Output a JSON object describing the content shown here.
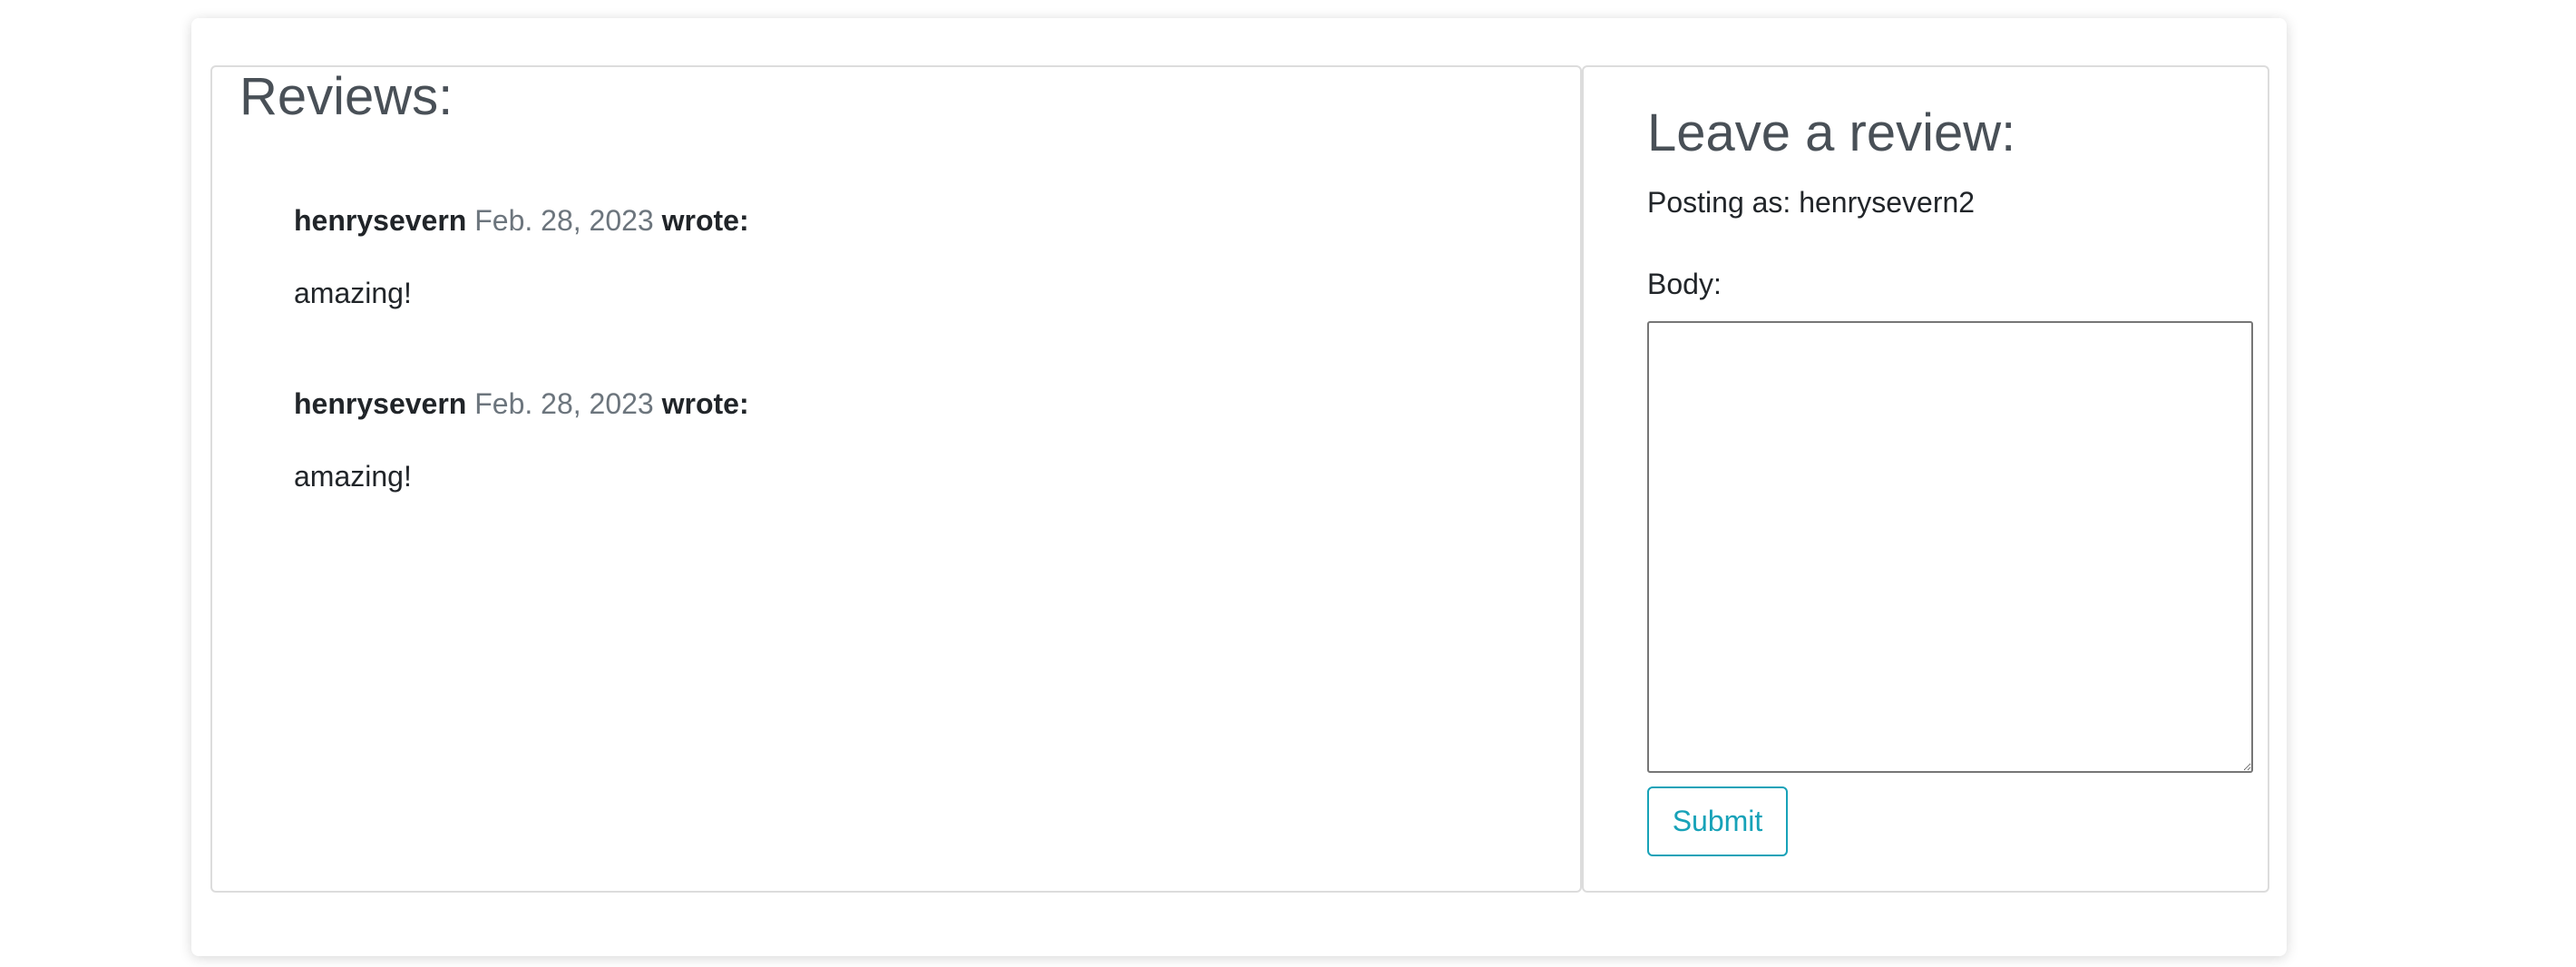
{
  "reviews": {
    "title": "Reviews:",
    "items": [
      {
        "author": "henrysevern",
        "date": "Feb. 28, 2023",
        "wrote": "wrote:",
        "body": "amazing!"
      },
      {
        "author": "henrysevern",
        "date": "Feb. 28, 2023",
        "wrote": "wrote:",
        "body": "amazing!"
      }
    ]
  },
  "form": {
    "title": "Leave a review:",
    "posting_as": "Posting as: henrysevern2",
    "body_label": "Body:",
    "body_value": "",
    "submit_label": "Submit"
  },
  "colors": {
    "accent": "#17a2b8",
    "muted": "#6c757d",
    "heading": "#495057"
  }
}
